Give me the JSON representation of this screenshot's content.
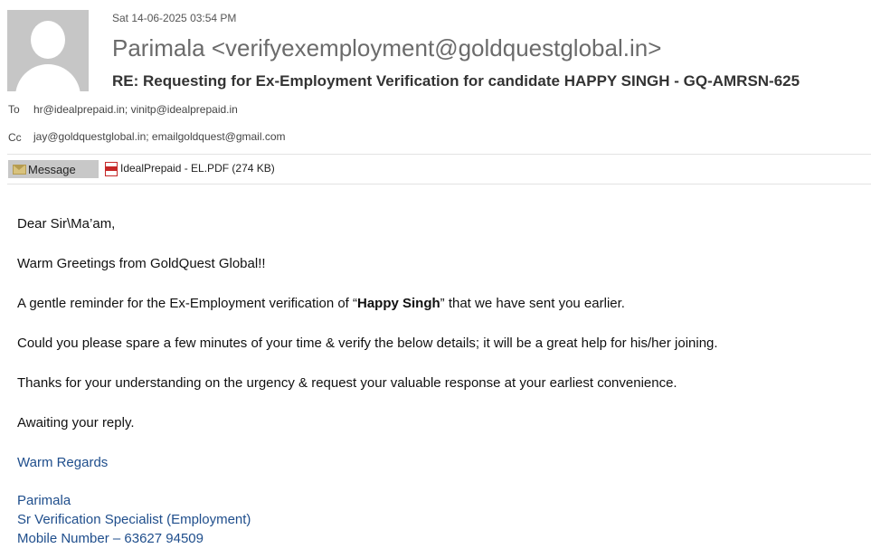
{
  "email": {
    "date": "Sat 14-06-2025 03:54 PM",
    "sender": "Parimala <verifyexemployment@goldquestglobal.in>",
    "subject": "RE: Requesting for Ex-Employment Verification for candidate HAPPY SINGH - GQ-AMRSN-625",
    "to_label": "To",
    "to_value": "hr@idealprepaid.in; vinitp@idealprepaid.in",
    "cc_label": "Cc",
    "cc_value": "jay@goldquestglobal.in; emailgoldquest@gmail.com"
  },
  "tabs": {
    "message_label": "Message",
    "attachment_name": "IdealPrepaid - EL.PDF (274 KB)",
    "envelope_icon": "envelope-icon",
    "pdf_icon": "pdf-icon"
  },
  "body": {
    "greeting": "Dear Sir\\Ma’am,",
    "line1": "Warm Greetings from GoldQuest Global!!",
    "line2_pre": "A gentle reminder for the Ex-Employment verification of “",
    "line2_bold": "Happy Singh",
    "line2_post": "” that we have sent you earlier.",
    "line3": "Could you please spare a few minutes of your time & verify the below details; it will be a great  help for his/her joining.",
    "line4": "Thanks for your understanding on the urgency & request your valuable response at your earliest convenience.",
    "line5": "Awaiting your reply."
  },
  "signature": {
    "regards": "Warm Regards",
    "name": "Parimala",
    "title": "Sr Verification Specialist (Employment)",
    "mobile": "Mobile Number – 63627 94509",
    "color": "#1f4e8c"
  }
}
